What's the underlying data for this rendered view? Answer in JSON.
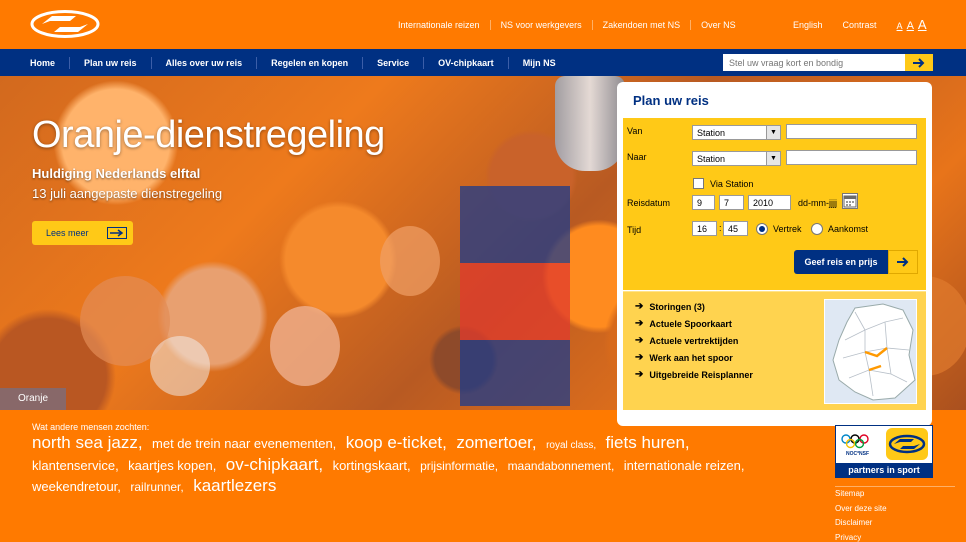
{
  "top": {
    "links": [
      "Internationale reizen",
      "NS voor werkgevers",
      "Zakendoen met NS",
      "Over NS"
    ],
    "english": "English",
    "contrast": "Contrast",
    "font_sizes": [
      "A",
      "A",
      "A"
    ]
  },
  "nav": {
    "items": [
      "Home",
      "Plan uw reis",
      "Alles over uw reis",
      "Regelen en kopen",
      "Service",
      "OV-chipkaart",
      "Mijn NS"
    ],
    "search_placeholder": "Stel uw vraag kort en bondig"
  },
  "hero": {
    "title": "Oranje-dienstregeling",
    "subtitle1": "Huldiging Nederlands elftal",
    "subtitle2": "13 juli aangepaste dienstregeling",
    "button": "Lees meer",
    "tag": "Oranje"
  },
  "planner": {
    "title": "Plan uw reis",
    "van_label": "Van",
    "naar_label": "Naar",
    "van_select": "Station",
    "naar_select": "Station",
    "via_label": "Via Station",
    "reisdatum_label": "Reisdatum",
    "day": "9",
    "month": "7",
    "year": "2010",
    "date_format": "dd-mm-jjjj",
    "tijd_label": "Tijd",
    "hour": "16",
    "minute": "45",
    "time_sep": ":",
    "vertrek": "Vertrek",
    "aankomst": "Aankomst",
    "submit": "Geef reis en prijs",
    "links": [
      "Storingen (3)",
      "Actuele Spoorkaart",
      "Actuele vertrektijden",
      "Werk aan het spoor",
      "Uitgebreide Reisplanner"
    ]
  },
  "searched": {
    "label": "Wat andere mensen zochten:",
    "tags": [
      {
        "text": "north sea jazz,",
        "size": "s4"
      },
      {
        "text": "met de trein naar evenementen,",
        "size": "s3"
      },
      {
        "text": "koop e-ticket,",
        "size": "s4"
      },
      {
        "text": "zomertoer,",
        "size": "s4"
      },
      {
        "text": "royal class,",
        "size": "s1"
      },
      {
        "text": "fiets huren,",
        "size": "s4"
      },
      {
        "text": "klantenservice,",
        "size": "s3"
      },
      {
        "text": "kaartjes kopen,",
        "size": "s3"
      },
      {
        "text": "ov-chipkaart,",
        "size": "s4"
      },
      {
        "text": "kortingskaart,",
        "size": "s3"
      },
      {
        "text": "prijsinformatie,",
        "size": "s2"
      },
      {
        "text": "maandabonnement,",
        "size": "s2"
      },
      {
        "text": "internationale reizen,",
        "size": "s3"
      },
      {
        "text": "weekendretour,",
        "size": "s3"
      },
      {
        "text": "railrunner,",
        "size": "s2"
      },
      {
        "text": "kaartlezers",
        "size": "s4"
      }
    ]
  },
  "partners": {
    "label": "partners in sport",
    "small": "NOC*NSF"
  },
  "footer": {
    "links": [
      "Sitemap",
      "Over deze site",
      "Disclaimer",
      "Privacy"
    ]
  },
  "colors": {
    "orange": "#ff7a00",
    "blue": "#003082",
    "yellow": "#ffc917"
  }
}
